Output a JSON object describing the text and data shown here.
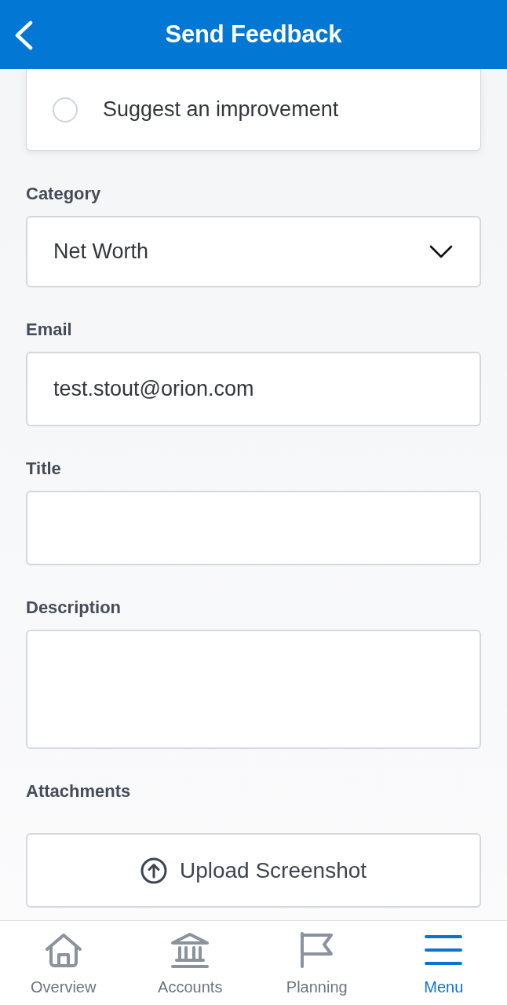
{
  "header": {
    "title": "Send Feedback"
  },
  "feedback_types": [
    {
      "label": "Suggest an improvement",
      "selected": false
    }
  ],
  "fields": [
    {
      "kind": "select",
      "label": "Category",
      "value": "Net Worth"
    },
    {
      "kind": "text",
      "label": "Email",
      "value": "test.stout@orion.com"
    },
    {
      "kind": "text",
      "label": "Title"
    },
    {
      "kind": "textarea",
      "label": "Description"
    }
  ],
  "attachments": {
    "label": "Attachments",
    "button": "Upload Screenshot"
  },
  "tabs": [
    {
      "label": "Overview",
      "selected": false
    },
    {
      "label": "Accounts",
      "selected": false
    },
    {
      "label": "Planning",
      "selected": false
    },
    {
      "label": "Menu",
      "selected": true
    }
  ]
}
